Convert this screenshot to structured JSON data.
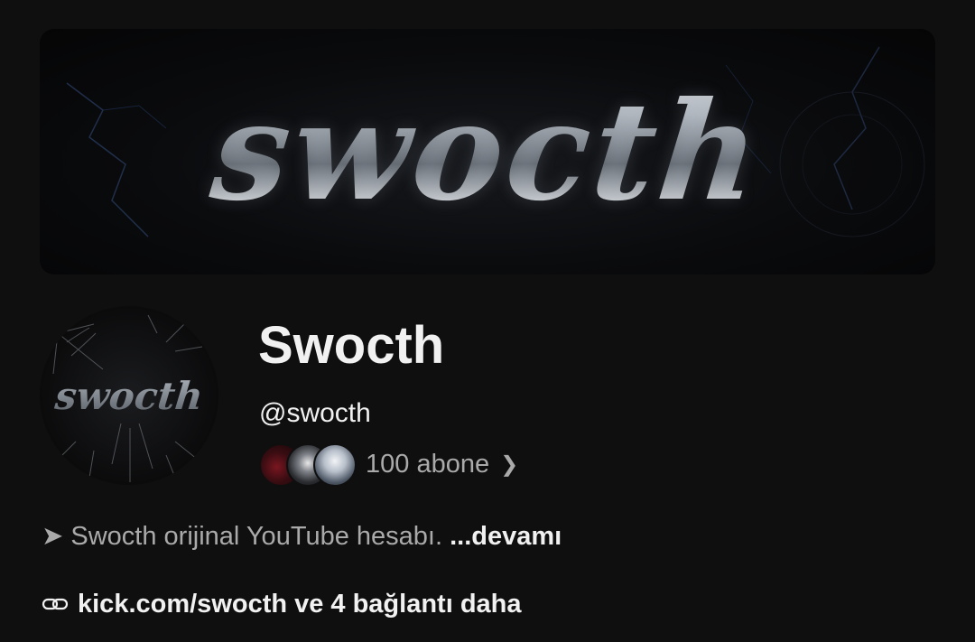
{
  "channel": {
    "banner_logo": "swocth",
    "avatar_logo": "swocth",
    "name": "Swocth",
    "handle": "@swocth",
    "subscribers": "100 abone",
    "subscriber_avatars": [
      "subscriber-avatar-red",
      "subscriber-avatar-gray",
      "subscriber-avatar-blue"
    ]
  },
  "description": {
    "bullet": "➤",
    "text": "Swocth orijinal YouTube hesabı.",
    "more": "...devamı"
  },
  "links": {
    "main": "kick.com/swocth",
    "more": "ve 4 bağlantı daha",
    "icon": "link-icon"
  },
  "colors": {
    "background": "#0f0f0f",
    "text_primary": "#f1f1f1",
    "text_secondary": "#aaaaaa"
  }
}
